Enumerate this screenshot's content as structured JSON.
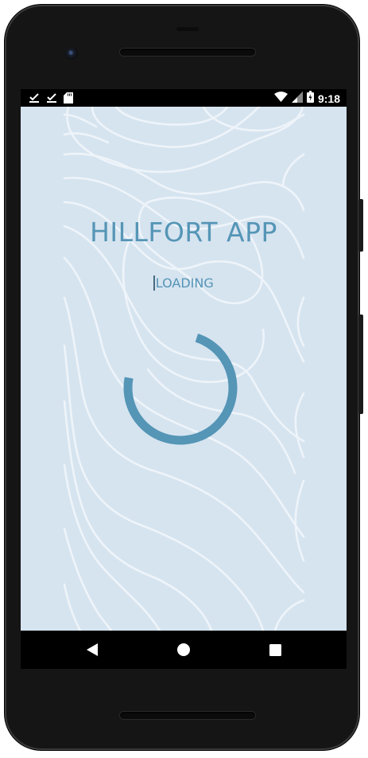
{
  "status_bar": {
    "time": "9:18",
    "left_icons": [
      "check-download-icon",
      "check-download-icon",
      "sd-card-icon"
    ],
    "right_icons": [
      "wifi-icon",
      "cell-signal-icon",
      "battery-charging-icon"
    ]
  },
  "splash": {
    "title": "HILLFORT APP",
    "loading_text": "LOADING",
    "progress": 0.73,
    "accent_color": "#5595b6",
    "background_color": "#d6e4f0"
  },
  "nav_bar": {
    "buttons": [
      "back-icon",
      "home-icon",
      "recents-icon"
    ]
  }
}
